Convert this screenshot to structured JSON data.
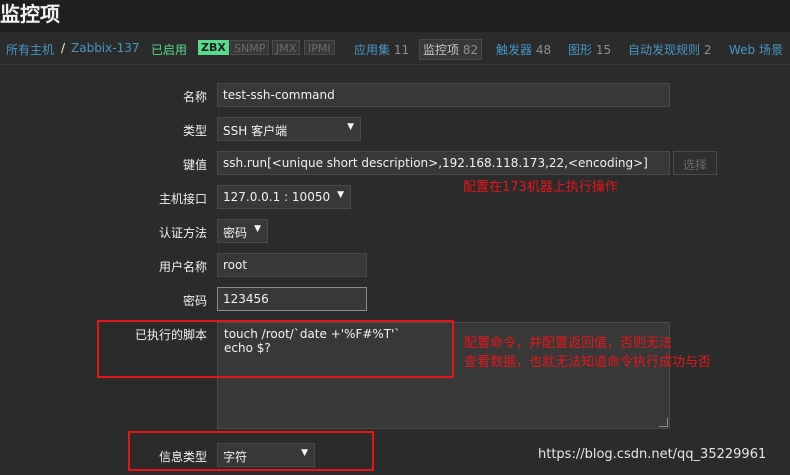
{
  "header": {
    "title": "监控项"
  },
  "nav": {
    "all_hosts": "所有主机",
    "separator": "/",
    "host": "Zabbix-137",
    "status": "已启用",
    "badges": [
      "ZBX",
      "SNMP",
      "JMX",
      "IPMI"
    ],
    "apps": {
      "label": "应用集",
      "count": "11"
    },
    "items": {
      "label": "监控项",
      "count": "82"
    },
    "triggers": {
      "label": "触发器",
      "count": "48"
    },
    "graphs": {
      "label": "图形",
      "count": "15"
    },
    "discovery": {
      "label": "自动发现规则",
      "count": "2"
    },
    "web": {
      "label": "Web 场景"
    }
  },
  "form": {
    "name": {
      "label": "名称",
      "value": "test-ssh-command"
    },
    "type": {
      "label": "类型",
      "value": "SSH 客户端"
    },
    "key": {
      "label": "键值",
      "value": "ssh.run[<unique short description>,192.168.118.173,22,<encoding>]",
      "button": "选择"
    },
    "interface": {
      "label": "主机接口",
      "value": "127.0.0.1 : 10050"
    },
    "auth": {
      "label": "认证方法",
      "value": "密码"
    },
    "username": {
      "label": "用户名称",
      "value": "root"
    },
    "password": {
      "label": "密码",
      "value": "123456"
    },
    "script": {
      "label": "已执行的脚本",
      "line1": "touch /root/`date +'%F#%T'`",
      "line2": "echo $?"
    },
    "info_type": {
      "label": "信息类型",
      "value": "字符"
    }
  },
  "annotations": {
    "note1": "配置在173机器上执行操作",
    "note2_line1": "配置命令，并配置返回值，否则无法",
    "note2_line2": "查看数据，也就无法知道命令执行成功与否"
  },
  "watermark": "https://blog.csdn.net/qq_35229961",
  "colors": {
    "accent": "#4796c4",
    "enabled": "#59db8f",
    "annotation": "#e5161b",
    "background": "#2b2b2b"
  }
}
